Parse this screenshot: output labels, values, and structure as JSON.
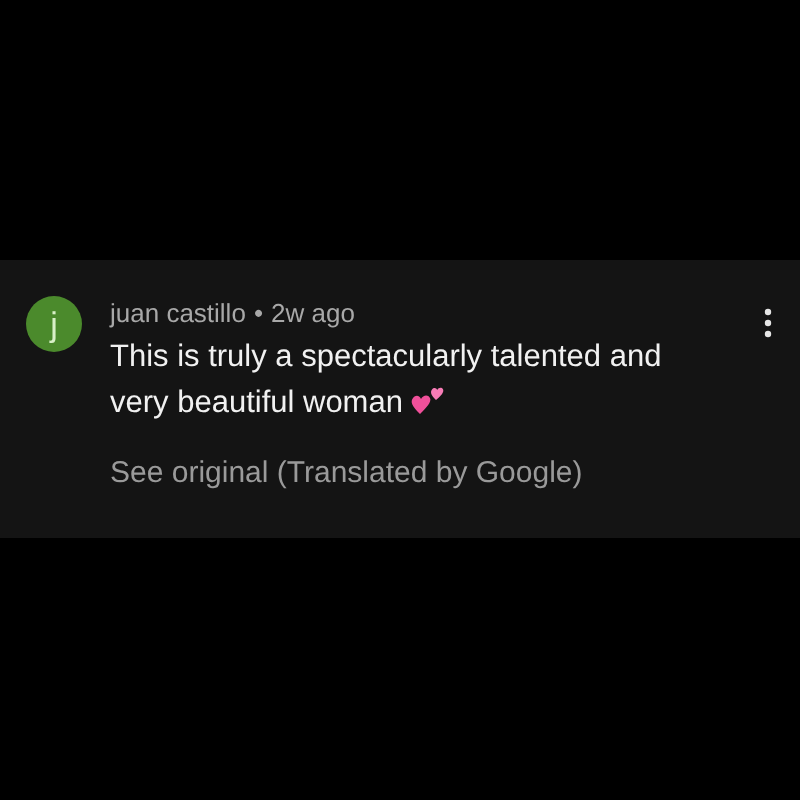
{
  "comment": {
    "avatar_letter": "j",
    "author": "juan castillo",
    "separator": "•",
    "time": "2w ago",
    "text_lines": [
      "This is truly a spectacularly talented and",
      "very beautiful woman"
    ],
    "translation_link": "See original (Translated by Google)"
  }
}
